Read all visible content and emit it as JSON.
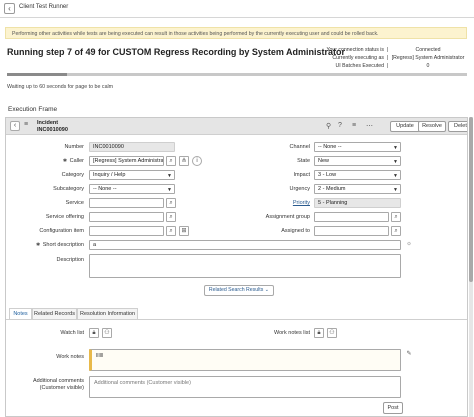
{
  "window": {
    "title": "Client Test Runner"
  },
  "warning": "Performing other activities while tests are being executed can result in those activities being performed by the currently executing user and could be rolled back.",
  "run": {
    "title": "Running step 7 of 49 for CUSTOM Regress Recording by System Administrator",
    "progress_fraction": 0.13,
    "wait_message": "Waiting up to 60 seconds for page to be calm"
  },
  "status": {
    "connection_label": "Your connection status is",
    "connection_value": "Connected",
    "executing_label": "Currently executing as",
    "executing_value": "[Regress] System Administrator",
    "batches_label": "UI Batches Executed",
    "batches_value": "0",
    "pipe": "|"
  },
  "execution_frame_label": "Execution Frame",
  "record": {
    "type": "Incident",
    "number": "INC0010090",
    "buttons": {
      "update": "Update",
      "resolve": "Resolve",
      "delete": "Delete"
    }
  },
  "form": {
    "number_label": "Number",
    "number_value": "INC0010090",
    "caller_label": "Caller",
    "caller_value": "[Regress] System Administrato",
    "category_label": "Category",
    "category_value": "Inquiry / Help",
    "subcategory_label": "Subcategory",
    "subcategory_value": "-- None --",
    "service_label": "Service",
    "service_offering_label": "Service offering",
    "config_item_label": "Configuration item",
    "short_desc_label": "Short description",
    "short_desc_value": "a",
    "description_label": "Description",
    "channel_label": "Channel",
    "channel_value": "-- None --",
    "state_label": "State",
    "state_value": "New",
    "impact_label": "Impact",
    "impact_value": "3 - Low",
    "urgency_label": "Urgency",
    "urgency_value": "2 - Medium",
    "priority_label": "Priority",
    "priority_value": "5 - Planning",
    "assignment_group_label": "Assignment group",
    "assigned_to_label": "Assigned to",
    "related_search": "Related Search Results",
    "required_mark": "✱"
  },
  "tabs": [
    {
      "label": "Notes"
    },
    {
      "label": "Related Records"
    },
    {
      "label": "Resolution Information"
    }
  ],
  "notes": {
    "watch_list_label": "Watch list",
    "work_notes_list_label": "Work notes list",
    "work_notes_label": "Work notes",
    "work_notes_value": "llllll",
    "additional_comments_label": "Additional comments",
    "additional_comments_sub": "(Customer visible)",
    "additional_comments_placeholder": "Additional comments (Customer visible)",
    "post": "Post"
  }
}
